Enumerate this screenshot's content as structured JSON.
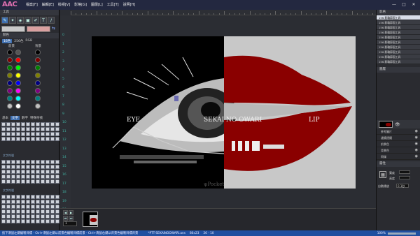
{
  "app": {
    "logo": "AAC"
  },
  "menu": [
    "檔案[F]",
    "編輯[E]",
    "檢視[V]",
    "影格[G]",
    "圖層[L]",
    "工具[T]",
    "說明[H]"
  ],
  "left_panel": {
    "tools_header": "工具",
    "color_header": "顏色",
    "color_tabs": [
      "16色",
      "256色",
      "RGB"
    ],
    "fg_label": "前景",
    "bg_label": "背景",
    "char_tabs": [
      "基本",
      "文字",
      "數字",
      "特殊符號"
    ],
    "group_a": "文字符號",
    "group_b": "文字符號"
  },
  "art": {
    "left_label": "EYE",
    "center_label": "SEKAI NO OWARI",
    "right_label": "LIP",
    "signature": "ψPocket"
  },
  "ruler_numbers": [
    "0",
    "1",
    "2",
    "3",
    "4",
    "5",
    "6",
    "7",
    "8",
    "9",
    "10",
    "11",
    "12",
    "13",
    "14",
    "15",
    "16",
    "17",
    "18",
    "19",
    "20",
    "21",
    "22"
  ],
  "right_panel": {
    "frames_header": "影格",
    "frames": [
      "156.影輪廓圖工具",
      "156.影輪廓圖工具",
      "156.影輪廓圖工具",
      "156.影輪廓圖工具",
      "156.影輪廓圖工具",
      "156.影輪廓圖工具",
      "156.影輪廓圖工具",
      "156.影輪廓圖工具",
      "156.影輪廓圖工具",
      "156.影輪廓圖工具"
    ],
    "layers_header": "圖層",
    "props": [
      "參考圖片",
      "濾鏡透鏡",
      "前景色",
      "背景色",
      "閃爍"
    ],
    "bottom_header": "屬性",
    "field_w": "寬度",
    "field_h": "高度",
    "delay_label": "自動播放",
    "delay_value": "0.1秒"
  },
  "timeline": {
    "frame_no": "1"
  },
  "status": {
    "hint": "按下滑鼠左鍵繪製目標 - Ctrl+滑鼠左鍵以前景色繪製目標前景 - Ctrl+滑鼠右鍵以背景色繪製目標背景",
    "file": "*PTT-SEKAINOOWARI.ans",
    "size": "80x23",
    "pos": "26 - 10",
    "zoom": "100%"
  }
}
